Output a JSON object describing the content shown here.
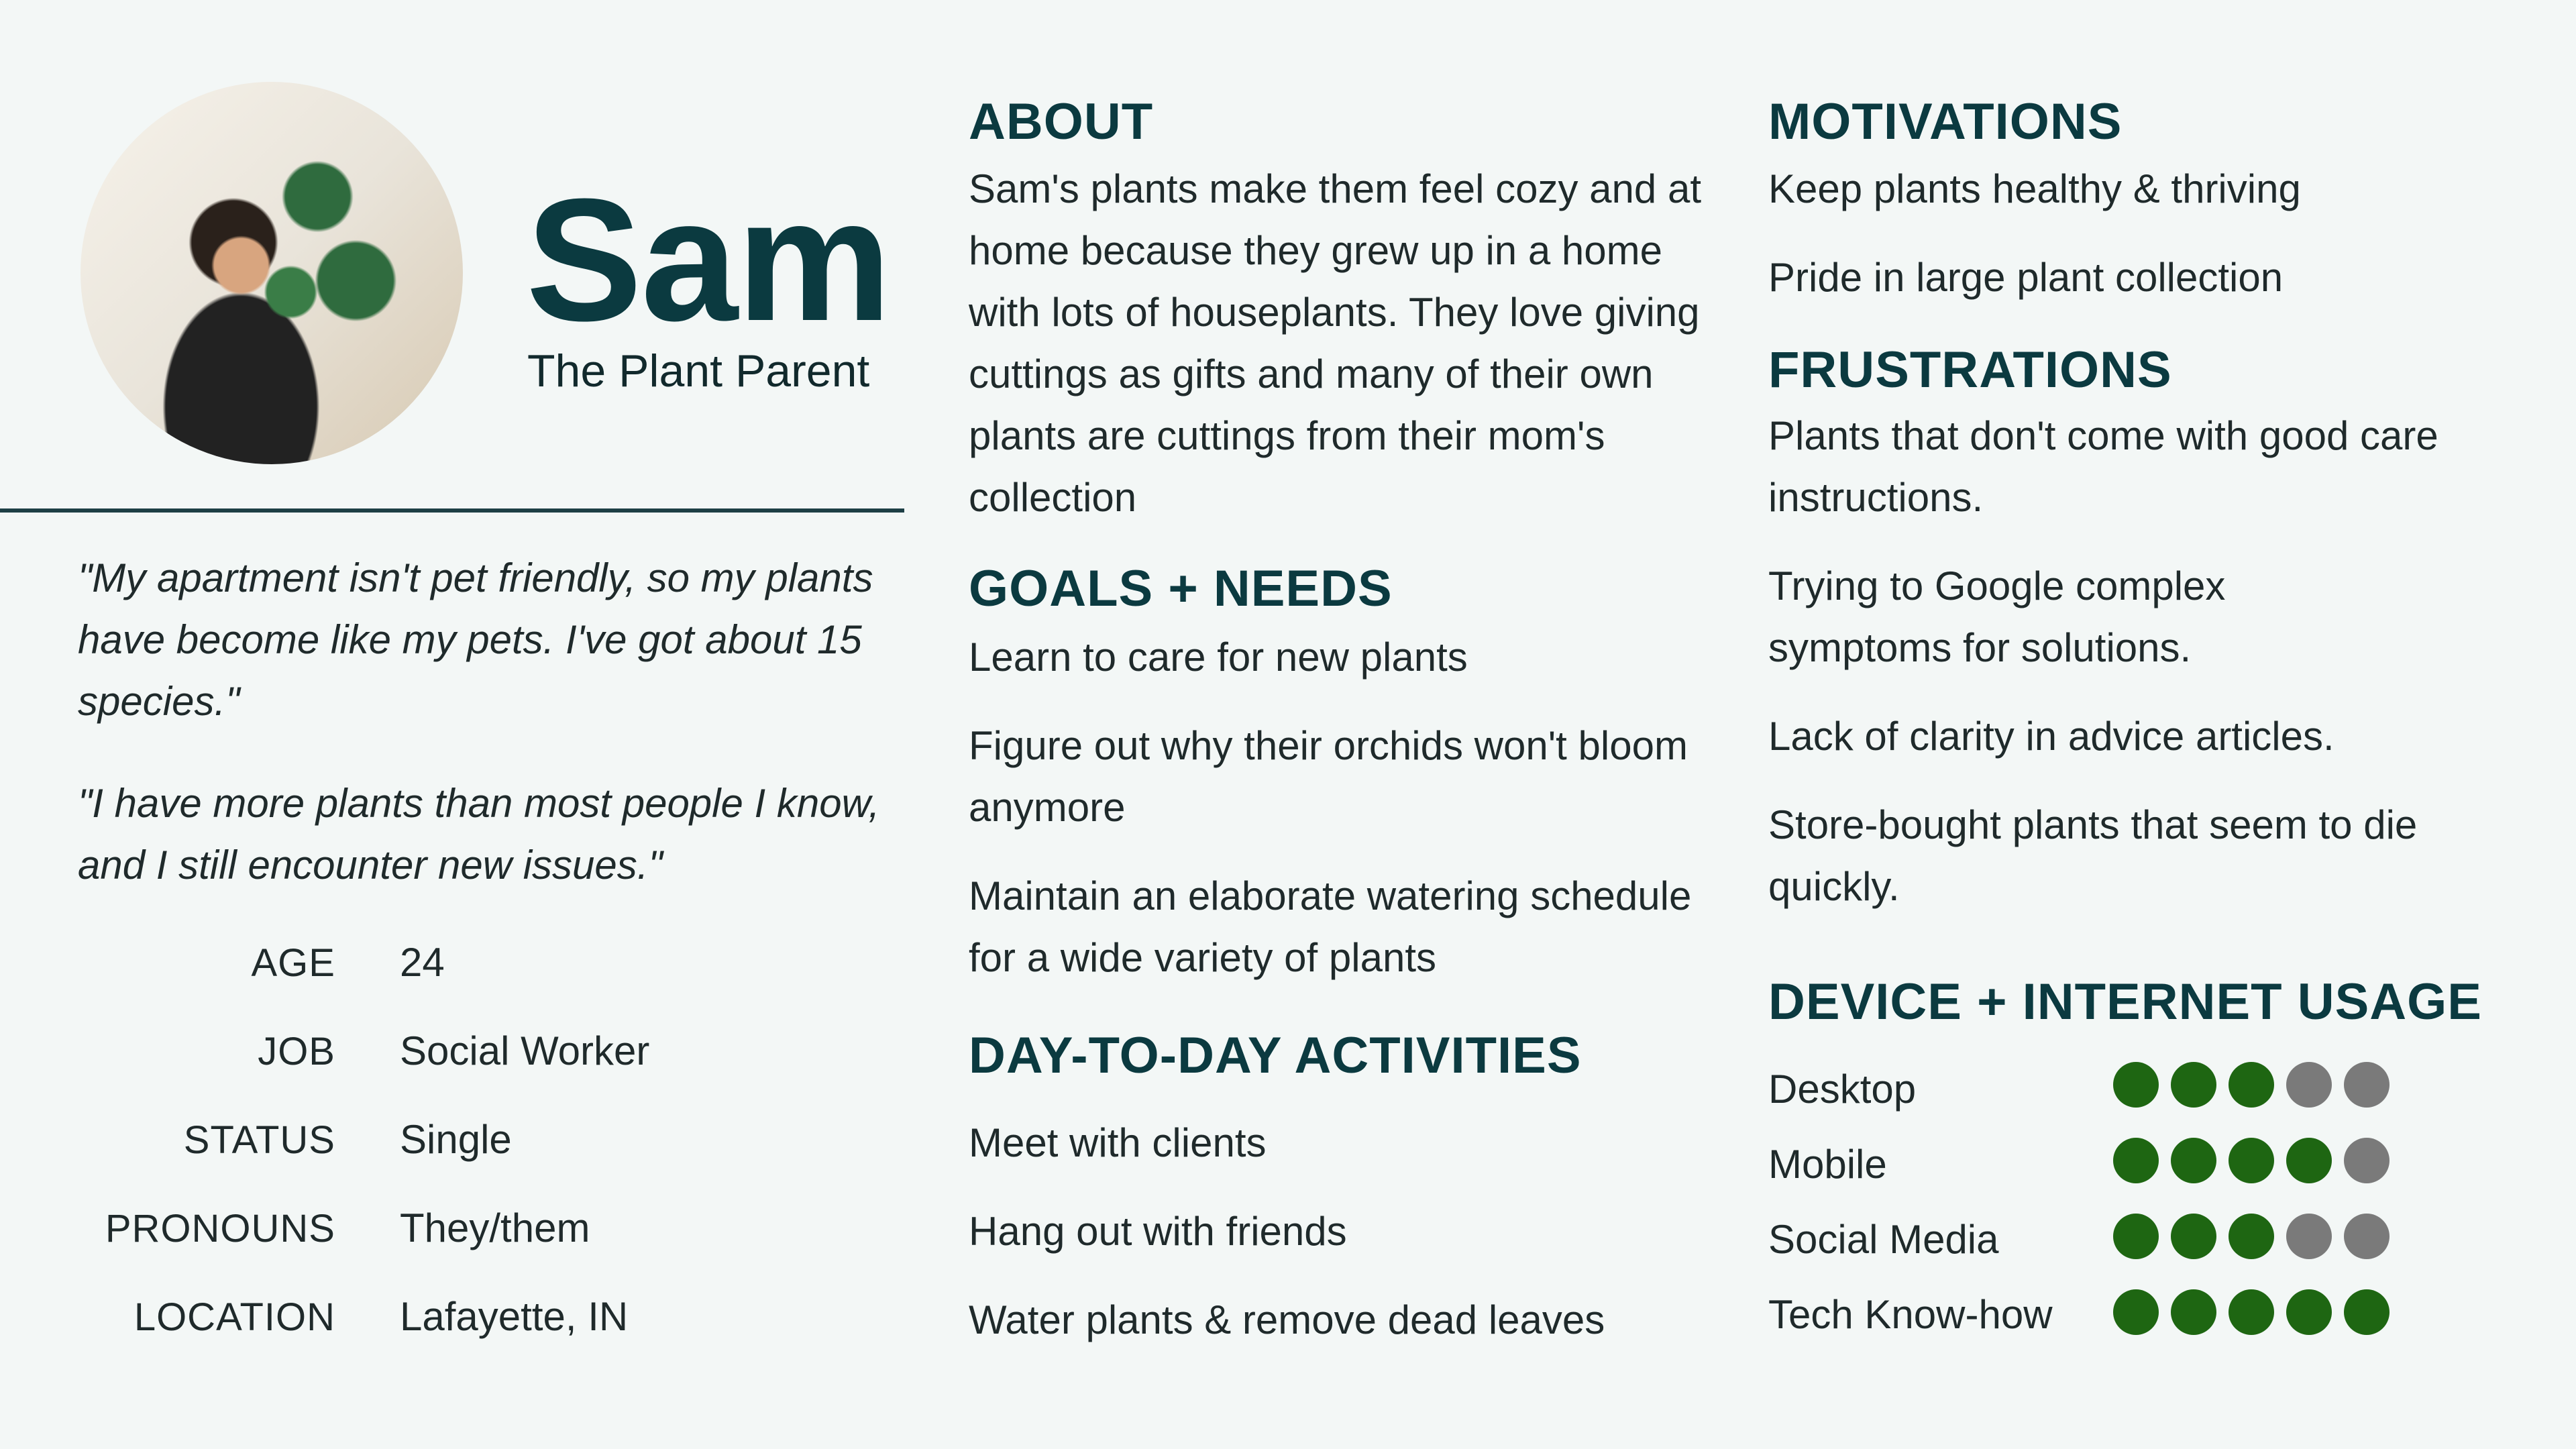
{
  "persona": {
    "name": "Sam",
    "title": "The Plant Parent",
    "quotes": [
      "\"My apartment isn't pet friendly, so my plants have become like my pets. I've got about 15 species.\"",
      "\"I have more plants than most people I know, and I still encounter new issues.\""
    ],
    "facts": [
      {
        "label": "AGE",
        "value": "24"
      },
      {
        "label": "JOB",
        "value": "Social Worker"
      },
      {
        "label": "STATUS",
        "value": "Single"
      },
      {
        "label": "PRONOUNS",
        "value": "They/them"
      },
      {
        "label": "LOCATION",
        "value": "Lafayette, IN"
      }
    ]
  },
  "about": {
    "heading": "ABOUT",
    "text": "Sam's plants make them feel cozy and at home because they grew up in a home with lots of houseplants. They love giving cuttings as gifts and many of their own plants are cuttings from their mom's collection"
  },
  "goals": {
    "heading": "GOALS + NEEDS",
    "items": [
      "Learn to care for new plants",
      "Figure out why their orchids won't bloom anymore",
      "Maintain an elaborate watering schedule for a wide variety of plants"
    ]
  },
  "activities": {
    "heading": "DAY-TO-DAY ACTIVITIES",
    "items": [
      "Meet with clients",
      "Hang out with friends",
      "Water plants & remove dead leaves"
    ]
  },
  "motivations": {
    "heading": "MOTIVATIONS",
    "items": [
      "Keep plants healthy & thriving",
      "Pride in large plant collection"
    ]
  },
  "frustrations": {
    "heading": "FRUSTRATIONS",
    "items": [
      "Plants that don't come with good care instructions.",
      "Trying to Google complex symptoms for solutions.",
      "Lack of clarity in advice articles.",
      "Store-bought plants that seem to die quickly."
    ]
  },
  "usage": {
    "heading": "DEVICE + INTERNET USAGE",
    "max": 5,
    "colors": {
      "filled": "#1e6612",
      "empty": "#7a7a7a"
    },
    "items": [
      {
        "label": "Desktop",
        "level": 3
      },
      {
        "label": "Mobile",
        "level": 4
      },
      {
        "label": "Social Media",
        "level": 3
      },
      {
        "label": "Tech Know-how",
        "level": 5
      }
    ]
  }
}
